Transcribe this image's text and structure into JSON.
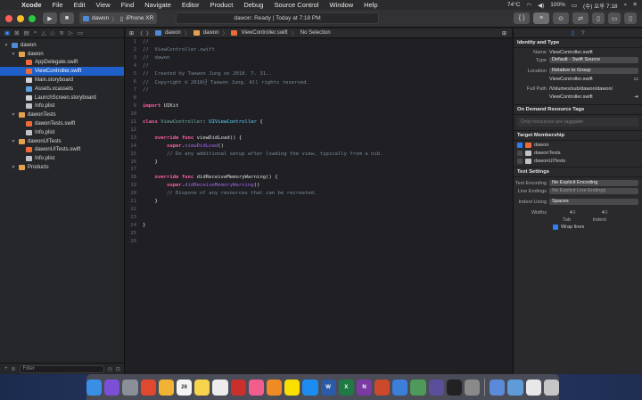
{
  "menubar": {
    "app": "Xcode",
    "items": [
      "File",
      "Edit",
      "View",
      "Find",
      "Navigate",
      "Editor",
      "Product",
      "Debug",
      "Source Control",
      "Window",
      "Help"
    ],
    "temperature": "74°C",
    "battery": "100%",
    "clock": "(수) 오후 7:18"
  },
  "toolbar": {
    "scheme": "dawon",
    "device": "iPhone XR",
    "activity": "dawon: Ready | Today at 7:18 PM"
  },
  "navigator": {
    "tree": [
      {
        "label": "dawon",
        "icon": "project-icon",
        "level": 0,
        "disclosure": true
      },
      {
        "label": "dawon",
        "icon": "folder-icon",
        "level": 1,
        "disclosure": true
      },
      {
        "label": "AppDelegate.swift",
        "icon": "swift-file-icon",
        "level": 2
      },
      {
        "label": "ViewController.swift",
        "icon": "swift-file-icon",
        "level": 2,
        "selected": true
      },
      {
        "label": "Main.storyboard",
        "icon": "storyboard-icon",
        "level": 2
      },
      {
        "label": "Assets.xcassets",
        "icon": "assets-icon",
        "level": 2
      },
      {
        "label": "LaunchScreen.storyboard",
        "icon": "storyboard-icon",
        "level": 2
      },
      {
        "label": "Info.plist",
        "icon": "plist-icon",
        "level": 2
      },
      {
        "label": "dawonTests",
        "icon": "folder-icon",
        "level": 1,
        "disclosure": true
      },
      {
        "label": "dawonTests.swift",
        "icon": "swift-file-icon",
        "level": 2
      },
      {
        "label": "Info.plist",
        "icon": "plist-icon",
        "level": 2
      },
      {
        "label": "dawonUITests",
        "icon": "folder-icon",
        "level": 1,
        "disclosure": true
      },
      {
        "label": "dawonUITests.swift",
        "icon": "swift-file-icon",
        "level": 2
      },
      {
        "label": "Info.plist",
        "icon": "plist-icon",
        "level": 2
      },
      {
        "label": "Products",
        "icon": "folder-icon",
        "level": 1,
        "disclosure": true
      }
    ],
    "filter_placeholder": "Filter"
  },
  "jumpbar": {
    "crumbs": [
      "dawon",
      "dawon",
      "ViewController.swift",
      "No Selection"
    ]
  },
  "editor": {
    "lines": [
      [
        [
          "c-comment",
          "//"
        ]
      ],
      [
        [
          "c-comment",
          "//  ViewController.swift"
        ]
      ],
      [
        [
          "c-comment",
          "//  dawon"
        ]
      ],
      [
        [
          "c-comment",
          "//"
        ]
      ],
      [
        [
          "c-comment",
          "//  Created by Taewon Jung on 2018. 7. 31.."
        ]
      ],
      [
        [
          "c-comment",
          "//  Copyright © 2018년 Taewon Jung. All rights reserved."
        ]
      ],
      [
        [
          "c-comment",
          "//"
        ]
      ],
      [],
      [
        [
          "c-kw",
          "import"
        ],
        [
          "code",
          " UIKit"
        ]
      ],
      [],
      [
        [
          "c-kw",
          "class"
        ],
        [
          "code",
          " "
        ],
        [
          "c-func",
          "ViewController"
        ],
        [
          "code",
          ": "
        ],
        [
          "c-type",
          "UIViewController"
        ],
        [
          "code",
          " {"
        ]
      ],
      [],
      [
        [
          "code",
          "    "
        ],
        [
          "c-kw",
          "override"
        ],
        [
          "code",
          " "
        ],
        [
          "c-kw",
          "func"
        ],
        [
          "code",
          " viewDidLoad() {"
        ]
      ],
      [
        [
          "code",
          "        "
        ],
        [
          "c-kw",
          "super"
        ],
        [
          "code",
          "."
        ],
        [
          "c-call",
          "viewDidLoad"
        ],
        [
          "code",
          "()"
        ]
      ],
      [
        [
          "code",
          "        "
        ],
        [
          "c-comment",
          "// Do any additional setup after loading the view, typically from a nib."
        ]
      ],
      [
        [
          "code",
          "    }"
        ]
      ],
      [],
      [
        [
          "code",
          "    "
        ],
        [
          "c-kw",
          "override"
        ],
        [
          "code",
          " "
        ],
        [
          "c-kw",
          "func"
        ],
        [
          "code",
          " didReceiveMemoryWarning() {"
        ]
      ],
      [
        [
          "code",
          "        "
        ],
        [
          "c-kw",
          "super"
        ],
        [
          "code",
          "."
        ],
        [
          "c-call",
          "didReceiveMemoryWarning"
        ],
        [
          "code",
          "()"
        ]
      ],
      [
        [
          "code",
          "        "
        ],
        [
          "c-comment",
          "// Dispose of any resources that can be recreated."
        ]
      ],
      [
        [
          "code",
          "    }"
        ]
      ],
      [],
      [],
      [
        [
          "code",
          "}"
        ]
      ],
      [],
      []
    ]
  },
  "inspector": {
    "identity_title": "Identity and Type",
    "name_label": "Name",
    "name_value": "ViewController.swift",
    "type_label": "Type",
    "type_value": "Default - Swift Source",
    "location_label": "Location",
    "location_value": "Relative to Group",
    "location_file": "ViewController.swift",
    "fullpath_label": "Full Path",
    "fullpath_value": "/Volumes/sub/dawon/dawon/",
    "fullpath_value2": "ViewController.swift",
    "odr_title": "On Demand Resource Tags",
    "odr_placeholder": "Only resources are taggable",
    "target_title": "Target Membership",
    "targets": [
      {
        "label": "dawon",
        "checked": true
      },
      {
        "label": "dawonTests",
        "checked": false
      },
      {
        "label": "dawonUITests",
        "checked": false
      }
    ],
    "text_title": "Text Settings",
    "encoding_label": "Text Encoding",
    "encoding_value": "No Explicit Encoding",
    "endings_label": "Line Endings",
    "endings_value": "No Explicit Line Endings",
    "indent_label": "Indent Using",
    "indent_value": "Spaces",
    "widths_label": "Widths",
    "tab_value": "4",
    "indent_num": "4",
    "tab_label": "Tab",
    "indent_sub_label": "Indent",
    "wrap_label": "Wrap lines"
  },
  "dock": {
    "icons": [
      {
        "name": "finder-icon",
        "color": "#3a8ee6",
        "label": ""
      },
      {
        "name": "siri-icon",
        "color": "#7b4fd6",
        "label": ""
      },
      {
        "name": "launchpad-icon",
        "color": "#8a8f99",
        "label": ""
      },
      {
        "name": "chrome-icon",
        "color": "#e0492f",
        "label": ""
      },
      {
        "name": "photos-icon",
        "color": "#f2b234",
        "label": ""
      },
      {
        "name": "calendar-icon",
        "color": "#f4f4f4",
        "label": "26"
      },
      {
        "name": "notes-icon",
        "color": "#f7d44b",
        "label": ""
      },
      {
        "name": "reminders-icon",
        "color": "#ececec",
        "label": ""
      },
      {
        "name": "photo-booth-icon",
        "color": "#c9302c",
        "label": ""
      },
      {
        "name": "itunes-icon",
        "color": "#f25d8e",
        "label": ""
      },
      {
        "name": "books-icon",
        "color": "#f08a24",
        "label": ""
      },
      {
        "name": "kakaotalk-icon",
        "color": "#f9e000",
        "label": ""
      },
      {
        "name": "appstore-icon",
        "color": "#1d8cf0",
        "label": ""
      },
      {
        "name": "word-icon",
        "color": "#2b5aa8",
        "label": "W"
      },
      {
        "name": "excel-icon",
        "color": "#1f7a44",
        "label": "X"
      },
      {
        "name": "onenote-icon",
        "color": "#7b3aa3",
        "label": "N"
      },
      {
        "name": "powerpoint-icon",
        "color": "#cc4a2c",
        "label": ""
      },
      {
        "name": "xcode-icon",
        "color": "#3c7fd9",
        "label": ""
      },
      {
        "name": "android-studio-icon",
        "color": "#4e9a5a",
        "label": ""
      },
      {
        "name": "visual-studio-icon",
        "color": "#5b4e9a",
        "label": ""
      },
      {
        "name": "terminal-icon",
        "color": "#222222",
        "label": ""
      },
      {
        "name": "system-preferences-icon",
        "color": "#8a8a8a",
        "label": ""
      },
      {
        "name": "preview-icon",
        "color": "#5b8ad8",
        "label": ""
      },
      {
        "name": "folder-dock-icon",
        "color": "#5e9bd8",
        "label": ""
      },
      {
        "name": "downloads-icon",
        "color": "#e8e8e8",
        "label": ""
      },
      {
        "name": "trash-icon",
        "color": "#c6c6c6",
        "label": ""
      }
    ]
  }
}
